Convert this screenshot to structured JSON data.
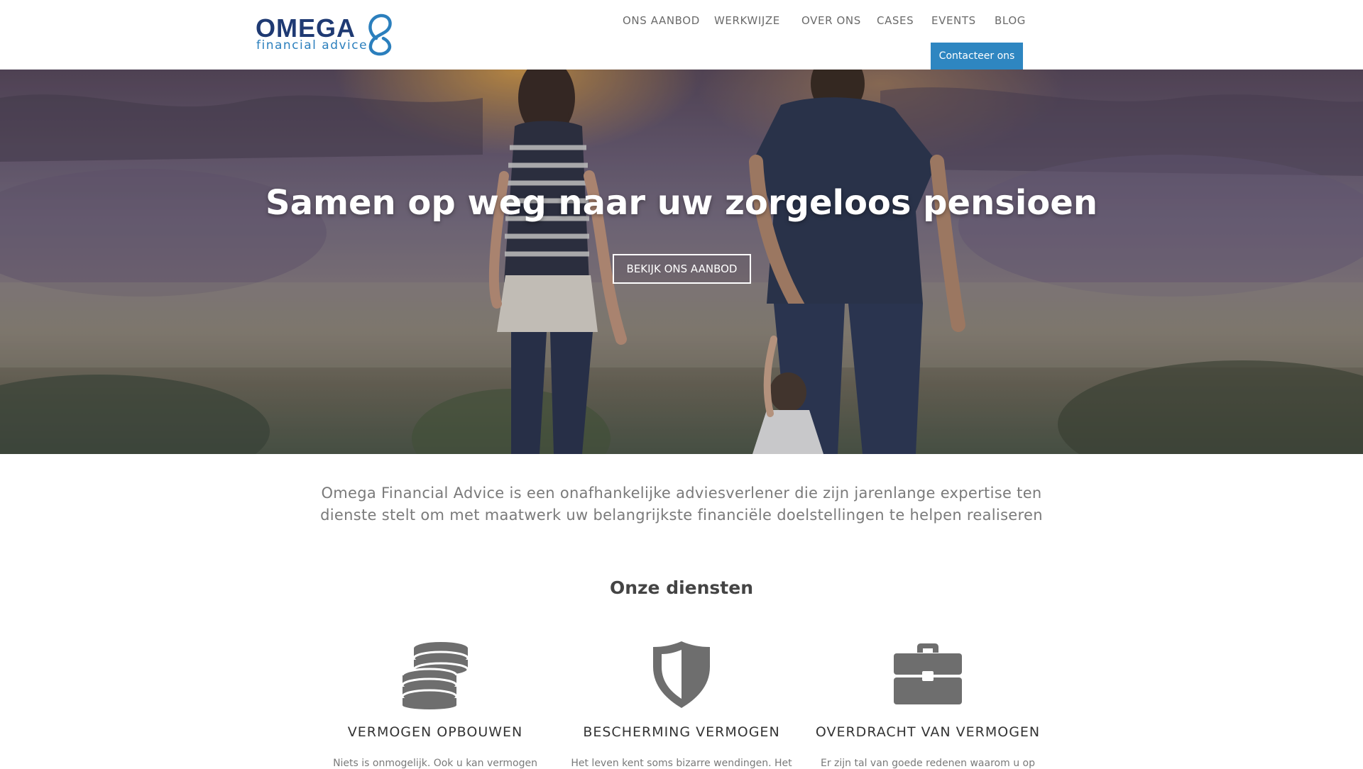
{
  "brand": {
    "name": "OMEGA",
    "tagline": "financial advice",
    "primary_color": "#1f3a73",
    "accent_color": "#2e86c1"
  },
  "nav": {
    "items": [
      {
        "label": "ONS AANBOD"
      },
      {
        "label": "WERKWIJZE"
      },
      {
        "label": "OVER ONS"
      },
      {
        "label": "CASES"
      },
      {
        "label": "EVENTS"
      },
      {
        "label": "BLOG"
      }
    ],
    "contact_label": "Contacteer ons"
  },
  "hero": {
    "title": "Samen op weg naar uw zorgeloos pensioen",
    "button_label": "BEKIJK ONS AANBOD"
  },
  "intro": {
    "text": "Omega Financial Advice is een onafhankelijke adviesverlener die zijn jarenlange expertise ten dienste stelt om met maatwerk uw belangrijkste financiële doelstellingen te helpen realiseren"
  },
  "services": {
    "title": "Onze diensten",
    "items": [
      {
        "title": "VERMOGEN OPBOUWEN",
        "icon": "coins-icon",
        "text": "Niets is onmogelijk. Ook u kan vermogen"
      },
      {
        "title": "BESCHERMING VERMOGEN",
        "icon": "shield-icon",
        "text": "Het leven kent soms bizarre wendingen. Het"
      },
      {
        "title": "OVERDRACHT VAN VERMOGEN",
        "icon": "briefcase-icon",
        "text": "Er zijn tal van goede redenen waarom u op"
      }
    ]
  }
}
